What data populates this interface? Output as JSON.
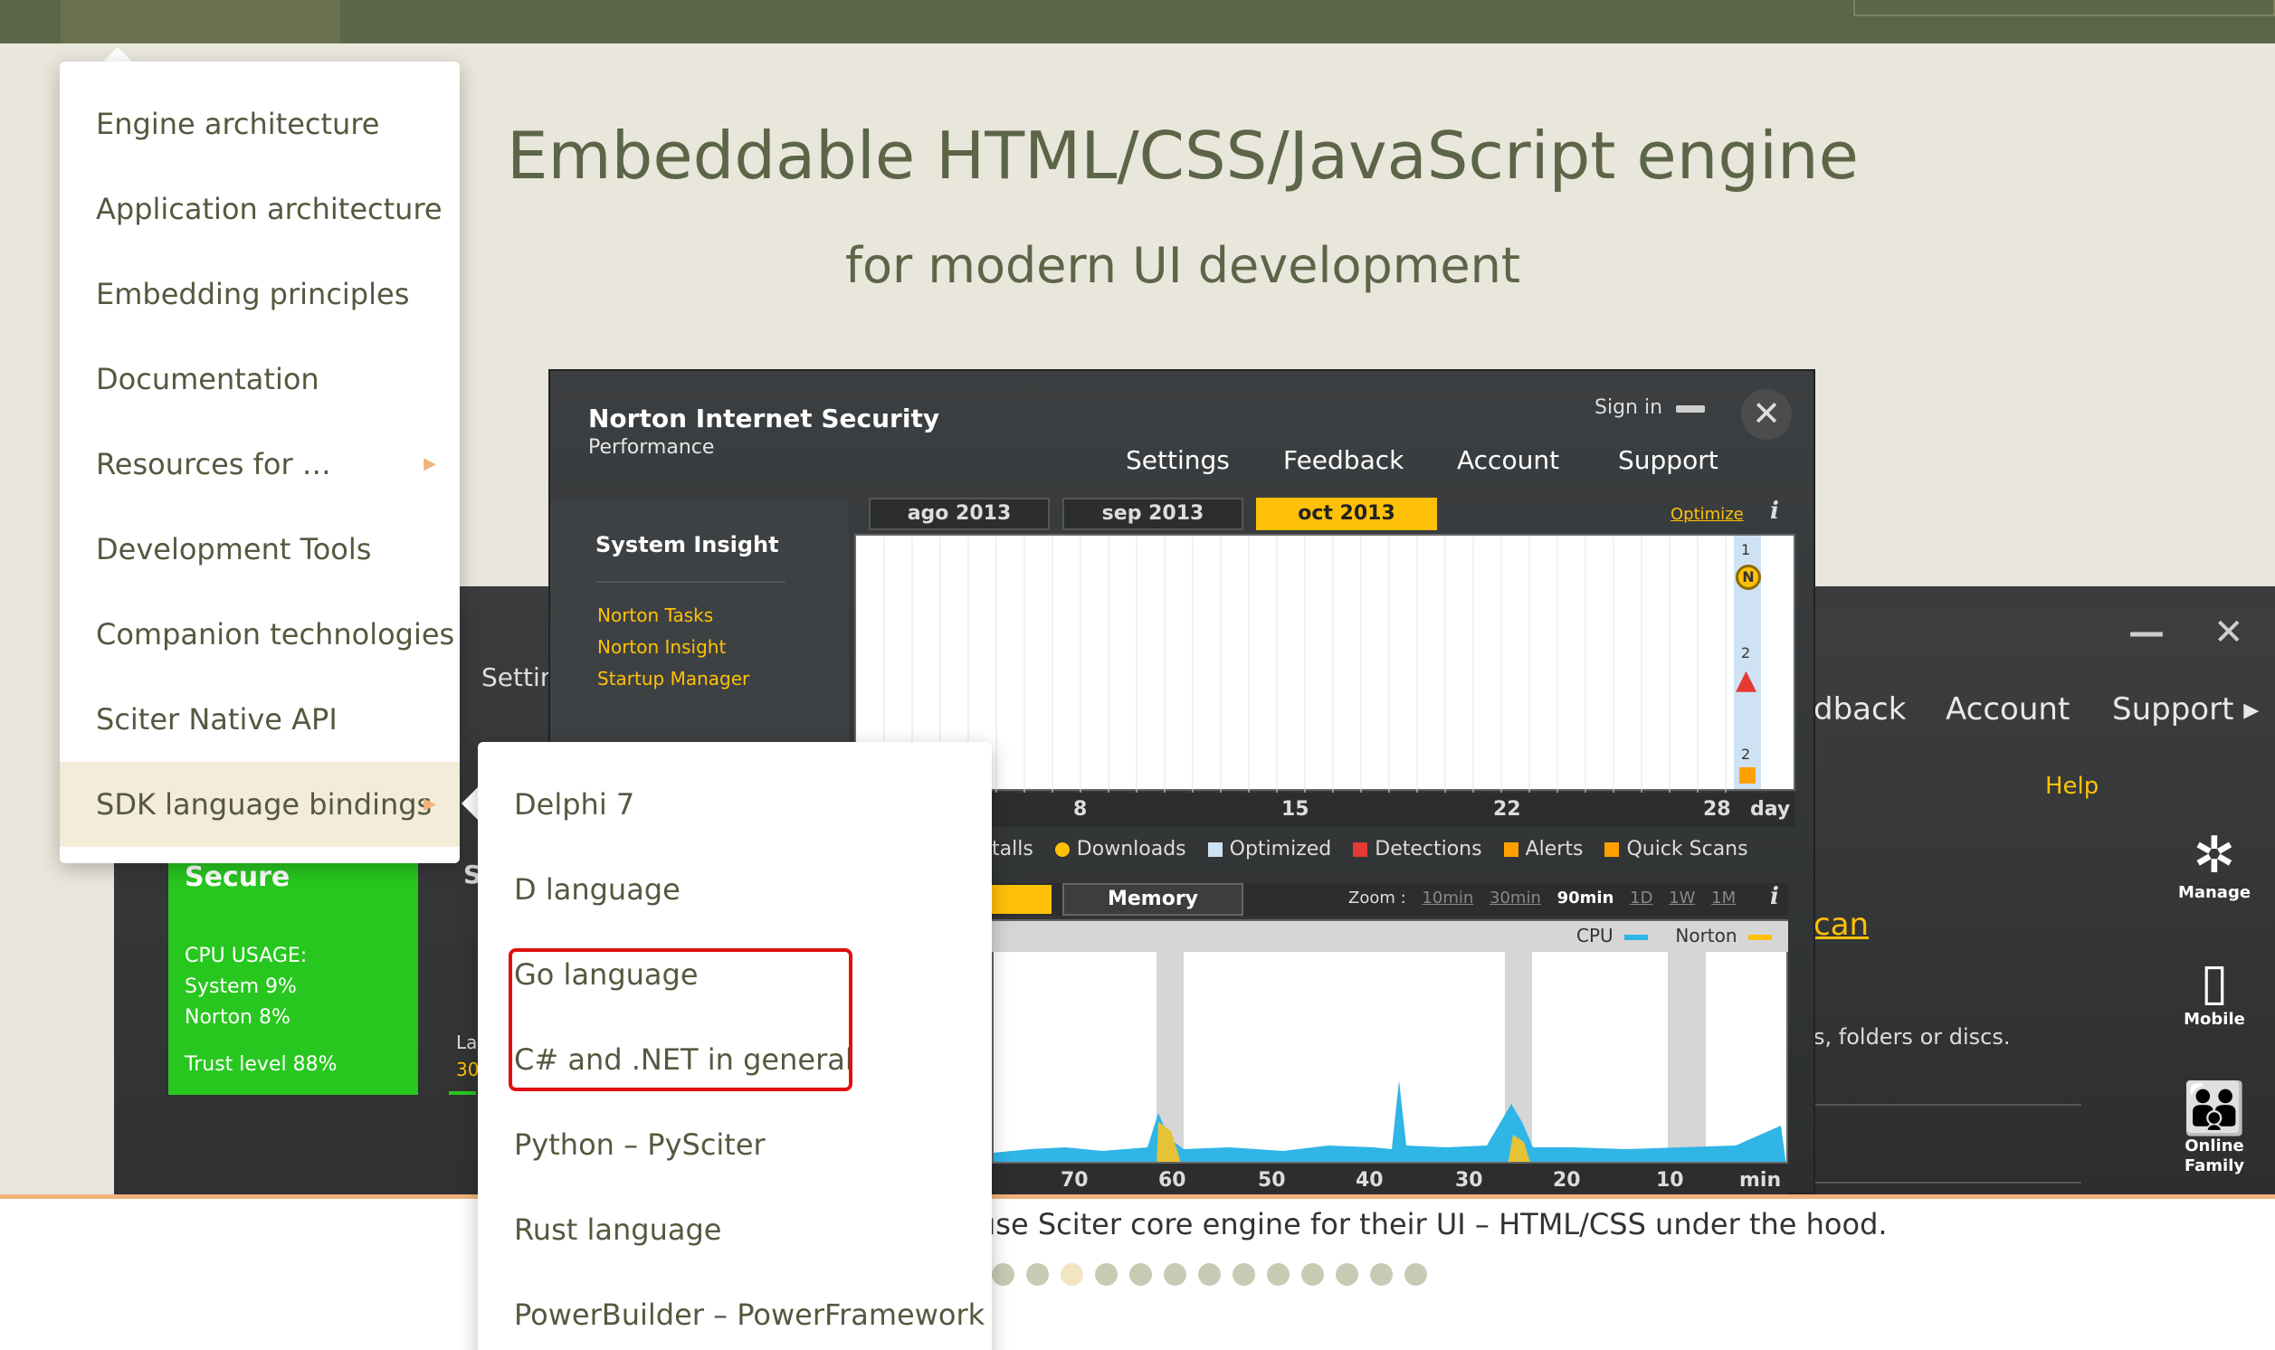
{
  "hero": {
    "title": "Embeddable HTML/CSS/JavaScript engine",
    "subtitle": "for modern UI development"
  },
  "main_menu": {
    "items": [
      {
        "label": "Engine architecture"
      },
      {
        "label": "Application architecture"
      },
      {
        "label": "Embedding principles"
      },
      {
        "label": "Documentation"
      },
      {
        "label": "Resources for …",
        "has_submenu": true
      },
      {
        "label": "Development Tools"
      },
      {
        "label": "Companion technologies"
      },
      {
        "label": "Sciter Native API"
      },
      {
        "label": "SDK language bindings",
        "has_submenu": true,
        "highlighted": true
      }
    ]
  },
  "sub_menu": {
    "items": [
      {
        "label": "Delphi 7"
      },
      {
        "label": "D language"
      },
      {
        "label": "Go language"
      },
      {
        "label": "C# and .NET in general"
      },
      {
        "label": "Python – PySciter"
      },
      {
        "label": "Rust language"
      },
      {
        "label": "PowerBuilder – PowerFramework"
      }
    ],
    "outlined_items": [
      "Go language",
      "C# and .NET in general"
    ],
    "outline_color": "#e01010"
  },
  "slide": {
    "caption": "use Sciter core engine for their UI – HTML/CSS under the hood.",
    "dots_total": 13,
    "active_dot": 2
  },
  "norton_front": {
    "title": "Norton Internet Security",
    "subtitle": "Performance",
    "sign_in": "Sign in",
    "close": "✕",
    "tabs": [
      "Settings",
      "Feedback",
      "Account",
      "Support"
    ],
    "left_heading": "System Insight",
    "left_links": [
      "Norton Tasks",
      "Norton Insight",
      "Startup Manager"
    ],
    "months": [
      "ago 2013",
      "sep 2013",
      "oct 2013"
    ],
    "active_month": "oct 2013",
    "optimize": "Optimize",
    "info": "i",
    "lane_nums": [
      "1",
      "2",
      "2"
    ],
    "lane_badge": "N",
    "top_axis": [
      "8",
      "15",
      "22",
      "28",
      "day"
    ],
    "legend": [
      {
        "label": "talls",
        "color": ""
      },
      {
        "label": "Downloads",
        "color": "#ffc107"
      },
      {
        "label": "Optimized",
        "color": "#cfe2f3"
      },
      {
        "label": "Detections",
        "color": "#e53935"
      },
      {
        "label": "Alerts",
        "color": "#ffa000"
      },
      {
        "label": "Quick Scans",
        "color": "#ffa000"
      }
    ],
    "memory_tab": "Memory",
    "zoom_label": "Zoom :",
    "zoom_options": [
      "10min",
      "30min",
      "90min",
      "1D",
      "1W",
      "1M"
    ],
    "zoom_selected": "90min",
    "cpu_label": "CPU",
    "norton_label": "Norton",
    "bottom_axis": [
      "70",
      "60",
      "50",
      "40",
      "30",
      "20",
      "10",
      "min"
    ],
    "accent": "#ffc107",
    "cpu_color": "#2fb5e6"
  },
  "norton_back": {
    "settin": "Settin",
    "tabs": [
      "dback",
      "Account",
      "Support ▸"
    ],
    "help": "Help",
    "scan": "can",
    "desc": "s, folders or discs.",
    "secure_title": "Secure",
    "cpu_lines": [
      "CPU USAGE:",
      "System 9%",
      "Norton 8%"
    ],
    "trust": "Trust level 88%",
    "s_frag": "S",
    "la_frag": "La",
    "num_frag": "30",
    "side_icons": [
      {
        "name": "Manage",
        "glyph": "✲"
      },
      {
        "name": "Mobile",
        "glyph": "▯"
      },
      {
        "name": "Online Family",
        "glyph": "👪"
      }
    ]
  }
}
